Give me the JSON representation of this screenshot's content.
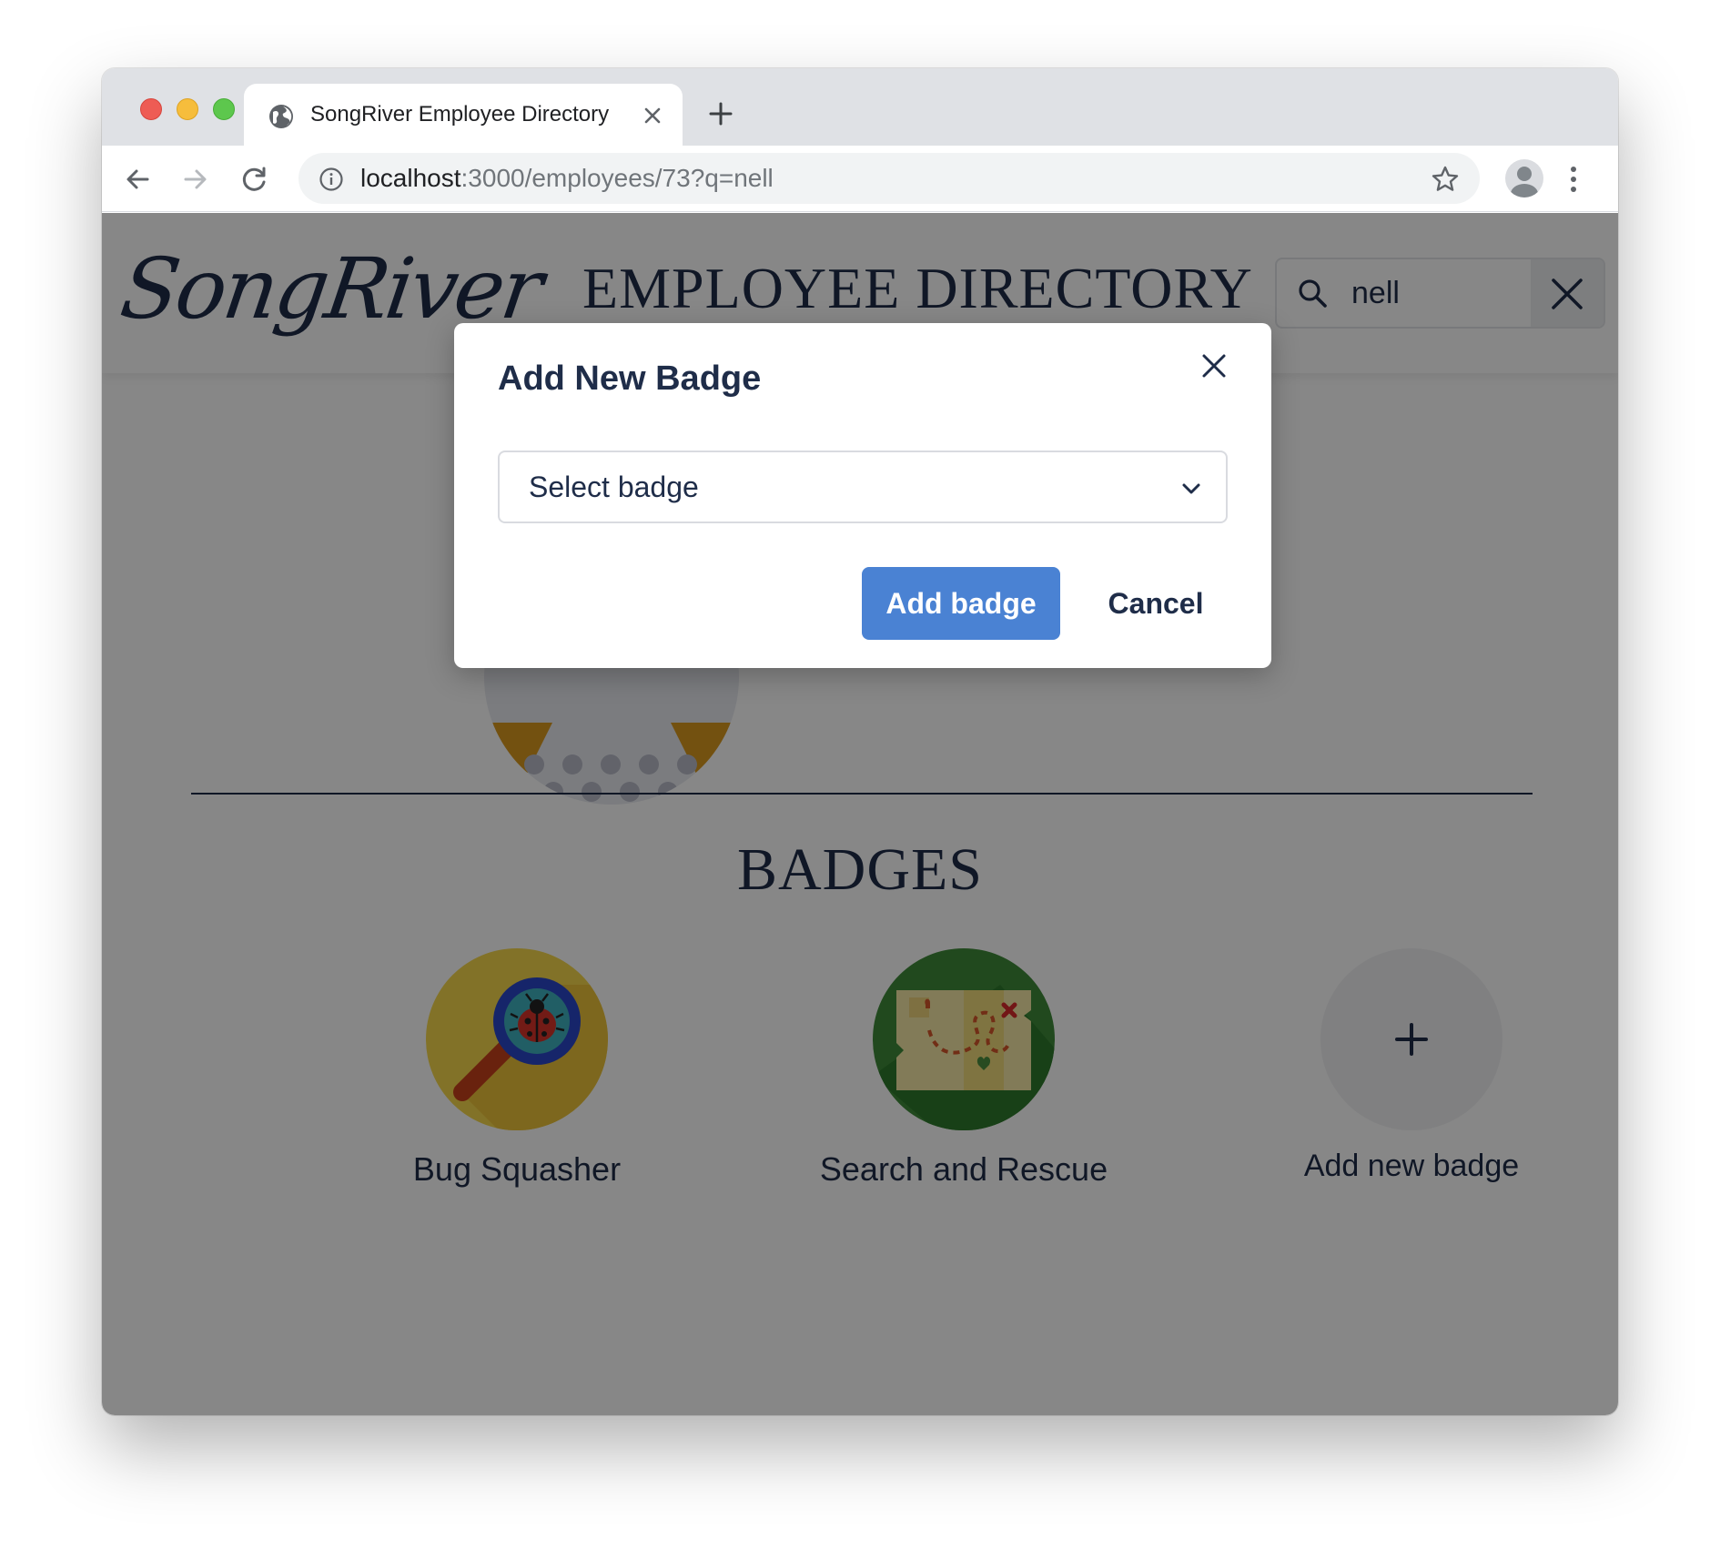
{
  "browser": {
    "tab_title": "SongRiver Employee Directory",
    "url_host": "localhost",
    "url_path": ":3000/employees/73?q=nell"
  },
  "header": {
    "logo_text": "SongRiver",
    "title": "EMPLOYEE DIRECTORY",
    "search_value": "nell"
  },
  "badges": {
    "title": "BADGES",
    "items": [
      {
        "label": "Bug Squasher",
        "icon": "magnifier-ladybug-icon"
      },
      {
        "label": "Search and Rescue",
        "icon": "treasure-map-icon"
      }
    ],
    "add_label": "Add new badge"
  },
  "modal": {
    "title": "Add New Badge",
    "select_placeholder": "Select badge",
    "add_button": "Add badge",
    "cancel_button": "Cancel"
  },
  "colors": {
    "navy": "#1f2d49",
    "primary_button": "#4a82d3",
    "overlay": "rgba(0,0,0,0.47)"
  }
}
